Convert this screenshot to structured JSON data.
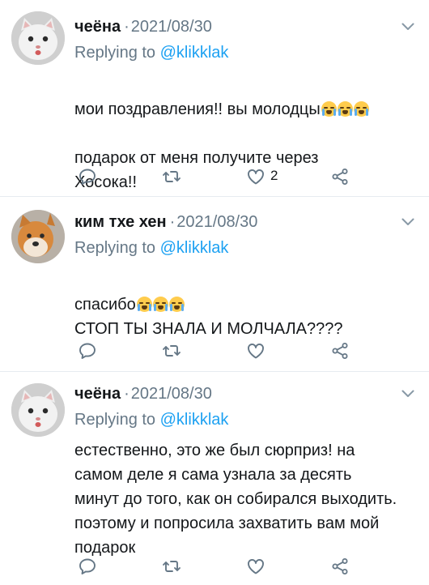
{
  "tweets": [
    {
      "name": "чеёна",
      "date": "2021/08/30",
      "reply_prefix": "Replying to ",
      "reply_handle": "@klikklak",
      "text1": "мои поздравления!! вы молодцы",
      "text2": "подарок от меня получите через\nХосока!!",
      "like_count": "2",
      "avatar": "cat-avatar"
    },
    {
      "name": "ким тхе хен",
      "date": "2021/08/30",
      "reply_prefix": "Replying to ",
      "reply_handle": "@klikklak",
      "text1": "спасибо",
      "text2": "СТОП ТЫ ЗНАЛА И МОЛЧАЛА????",
      "like_count": "",
      "avatar": "dog-avatar"
    },
    {
      "name": "чеёна",
      "date": "2021/08/30",
      "reply_prefix": "Replying to ",
      "reply_handle": "@klikklak",
      "text1": "естественно, это же был сюрприз! на самом деле я сама узнала за десять минут до того, как он собирался выходить. поэтому и попросила захватить вам мой подарок",
      "like_count": "",
      "avatar": "cat-avatar"
    }
  ],
  "icons": {
    "reply": "speech-bubble-icon",
    "retweet": "retweet-icon",
    "like": "heart-icon",
    "share": "share-icon",
    "menu": "chevron-down-icon",
    "emoji": "loudly-crying-face-emoji"
  },
  "colors": {
    "link": "#1da1f2",
    "muted": "#657786",
    "divider": "#e6ecf0"
  }
}
